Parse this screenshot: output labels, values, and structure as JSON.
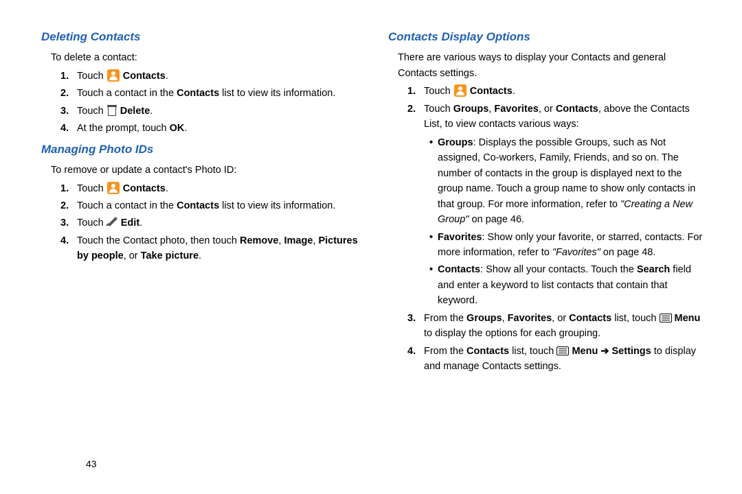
{
  "page_number": "43",
  "left": {
    "section1": {
      "title": "Deleting Contacts",
      "intro": "To delete a contact:",
      "step1_a": "Touch ",
      "step1_b": "Contacts",
      "step2_a": "Touch a contact in the ",
      "step2_b": "Contacts",
      "step2_c": " list to view its information.",
      "step3_a": "Touch ",
      "step3_b": "Delete",
      "step4_a": "At the prompt, touch ",
      "step4_b": "OK"
    },
    "section2": {
      "title": "Managing Photo IDs",
      "intro": "To remove or update a contact's Photo ID:",
      "step1_a": "Touch ",
      "step1_b": "Contacts",
      "step2_a": "Touch a contact in the ",
      "step2_b": "Contacts",
      "step2_c": " list to view its information.",
      "step3_a": "Touch ",
      "step3_b": "Edit",
      "step4_a": "Touch the Contact photo, then touch ",
      "step4_b": "Remove",
      "step4_c": ", ",
      "step4_d": "Image",
      "step4_e": ", ",
      "step4_f": "Pictures by people",
      "step4_g": ", or ",
      "step4_h": "Take picture"
    }
  },
  "right": {
    "title": "Contacts Display Options",
    "intro": "There are various ways to display your Contacts and general Contacts settings.",
    "step1_a": "Touch ",
    "step1_b": "Contacts",
    "step2_a": "Touch ",
    "step2_b": "Groups",
    "step2_c": ", ",
    "step2_d": "Favorites",
    "step2_e": ", or ",
    "step2_f": "Contacts",
    "step2_g": ", above the Contacts List, to view contacts various ways:",
    "bullet1_a": "Groups",
    "bullet1_b": ": Displays the possible Groups, such as Not assigned, Co-workers, Family, Friends, and so on. The number of contacts in the group is displayed next to the group name. Touch a group name to show only contacts in that group. For more information, refer to ",
    "bullet1_c": "\"Creating a New Group\"",
    "bullet1_d": " on page 46.",
    "bullet2_a": "Favorites",
    "bullet2_b": ": Show only your favorite, or starred, contacts. For more information, refer to ",
    "bullet2_c": "\"Favorites\"",
    "bullet2_d": " on page 48.",
    "bullet3_a": "Contacts",
    "bullet3_b": ": Show all your contacts. Touch the ",
    "bullet3_c": "Search",
    "bullet3_d": " field and enter a keyword to list contacts that contain that keyword.",
    "step3_a": "From the ",
    "step3_b": "Groups",
    "step3_c": ", ",
    "step3_d": "Favorites",
    "step3_e": ", or ",
    "step3_f": "Contacts",
    "step3_g": " list, touch ",
    "step3_h": "Menu",
    "step3_i": " to display the options for each grouping.",
    "step4_a": "From the ",
    "step4_b": "Contacts",
    "step4_c": " list, touch ",
    "step4_d": "Menu",
    "step4_arrow": " ➔ ",
    "step4_e": "Settings",
    "step4_f": " to display and manage Contacts settings."
  }
}
